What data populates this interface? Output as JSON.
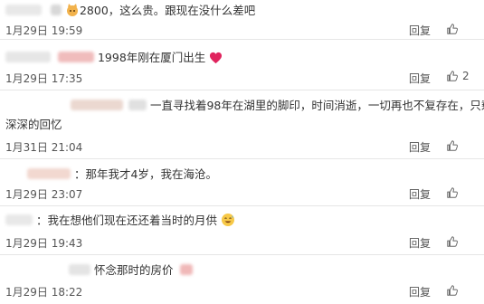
{
  "comments": [
    {
      "text": "2800，这么贵。跟现在没什么差吧",
      "date": "1月29日 19:59",
      "reply": "回复",
      "likes": ""
    },
    {
      "text": "1998年刚在厦门出生",
      "date": "1月29日 17:35",
      "reply": "回复",
      "likes": "2"
    },
    {
      "text_line1": "一直寻找着98年在湖里的脚印，时间消逝，一切再也不复存在，只剩下",
      "text_line2": "深深的回忆",
      "date": "1月31日 21:04",
      "reply": "回复",
      "likes": ""
    },
    {
      "text": "：那年我才4岁，我在海沧。",
      "date": "1月29日 23:07",
      "reply": "回复",
      "likes": ""
    },
    {
      "text": "：我在想他们现在还还着当时的月供",
      "date": "1月29日 19:43",
      "reply": "回复",
      "likes": ""
    },
    {
      "text": "怀念那时的房价",
      "date": "1月29日 18:22",
      "reply": "回复",
      "likes": ""
    }
  ],
  "icons": {
    "like": "thumbs-up-icon",
    "heart": "red-heart-emoji",
    "laugh": "sweat-smile-emoji",
    "avatar_emoji": "cat-emoji"
  },
  "colors": {
    "heart": "#e0245e",
    "blurred_name": "#f4c6c6"
  }
}
